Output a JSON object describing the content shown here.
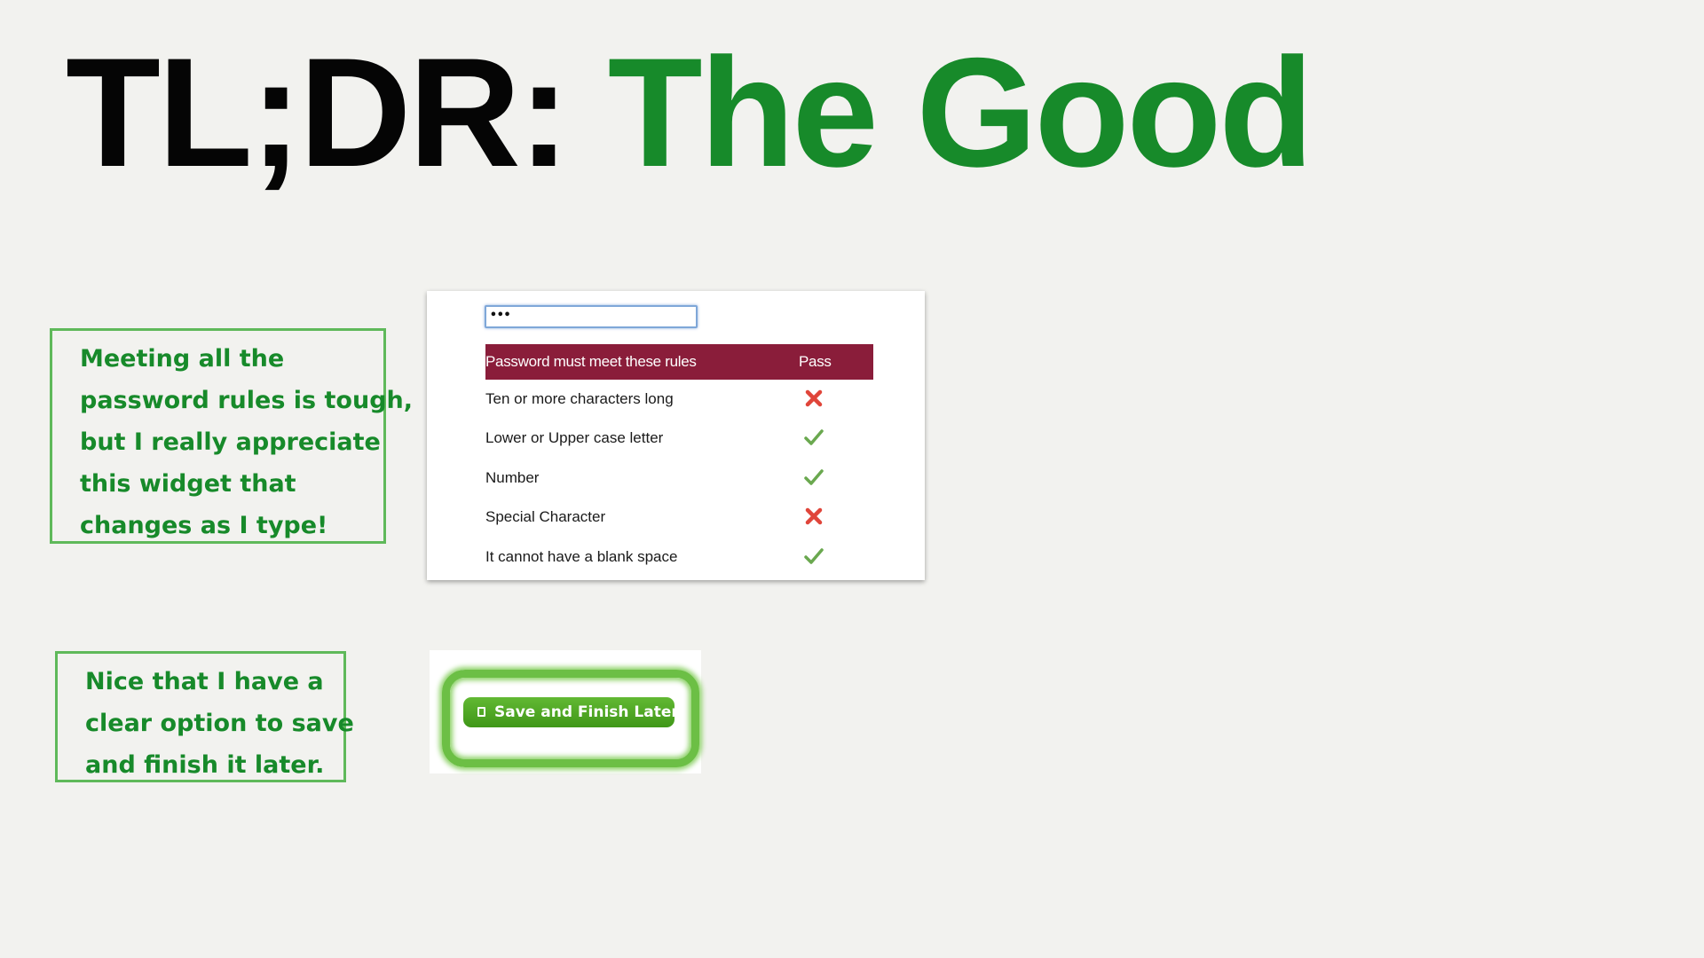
{
  "title": {
    "prefix": "TL;DR:",
    "highlight": "The Good"
  },
  "notes": [
    {
      "lines": [
        "Meeting all the",
        "password rules is tough,",
        "but I really appreciate",
        "this widget that",
        "changes as I type!"
      ]
    },
    {
      "lines": [
        "Nice that I have a",
        "clear option to save",
        "and finish it later."
      ]
    }
  ],
  "password_widget": {
    "input_value": "•••",
    "header_rule": "Password must meet these rules",
    "header_pass": "Pass",
    "rules": [
      {
        "label": "Ten or more characters long",
        "icon": "x-icon",
        "pass": false
      },
      {
        "label": "Lower or Upper case letter",
        "icon": "check-icon",
        "pass": true
      },
      {
        "label": "Number",
        "icon": "check-icon",
        "pass": true
      },
      {
        "label": "Special Character",
        "icon": "x-icon",
        "pass": false
      },
      {
        "label": "It cannot have a blank space",
        "icon": "check-icon",
        "pass": true
      }
    ],
    "colors": {
      "header_bg": "#8a1d3a",
      "check": "#6aa84f",
      "x": "#e0453a"
    }
  },
  "save_button": {
    "label": "Save and Finish Later",
    "icon": "document-icon",
    "color": "#4fa821"
  },
  "colors": {
    "background": "#f2f2ef",
    "accent_green": "#178a2a",
    "note_border": "#5fb95a"
  }
}
